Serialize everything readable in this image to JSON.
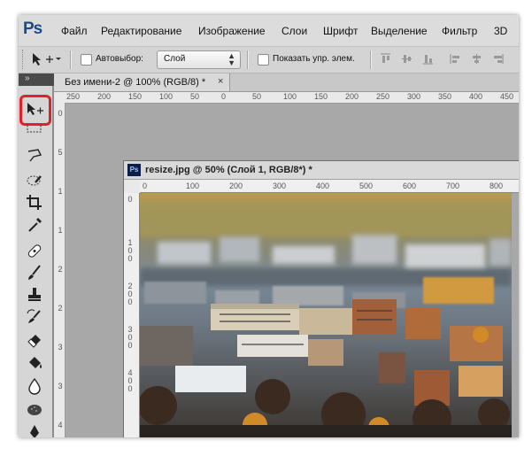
{
  "app": {
    "logo": "Ps"
  },
  "menu": [
    "Файл",
    "Редактирование",
    "Изображение",
    "Слои",
    "Шрифт",
    "Выделение",
    "Фильтр",
    "3D"
  ],
  "options": {
    "autoselect_label": "Автовыбор:",
    "autoselect_value": "Слой",
    "show_controls_label": "Показать упр. элем."
  },
  "tabs": [
    {
      "title": "Без имени-2 @ 100% (RGB/8) *",
      "close": "×"
    }
  ],
  "toolbox_header": "»",
  "rulers": {
    "main_h": [
      "250",
      "200",
      "150",
      "100",
      "50",
      "0",
      "50",
      "100",
      "150",
      "200",
      "250",
      "300",
      "350",
      "400",
      "450"
    ],
    "main_v": [
      "0",
      "5",
      "1",
      "1",
      "2",
      "2",
      "3",
      "3",
      "4"
    ],
    "doc_h": [
      "0",
      "100",
      "200",
      "300",
      "400",
      "500",
      "600",
      "700",
      "800"
    ],
    "doc_v": [
      "0",
      "1 0 0",
      "2 0 0",
      "3 0 0",
      "4 0 0"
    ]
  },
  "document": {
    "title": "resize.jpg @ 50% (Слой 1, RGB/8*) *",
    "icon": "Ps"
  },
  "tools": [
    "move-tool",
    "marquee-tool",
    "lasso-tool",
    "quick-selection-tool",
    "crop-tool",
    "eyedropper-tool",
    "healing-brush-tool",
    "brush-tool",
    "clone-stamp-tool",
    "history-brush-tool",
    "eraser-tool",
    "paint-bucket-tool",
    "blur-tool",
    "dodge-tool",
    "pen-tool"
  ],
  "colors": {
    "highlight": "#e0202a",
    "menubar": "#dcdcdc",
    "workspace": "#a8a8a8"
  }
}
